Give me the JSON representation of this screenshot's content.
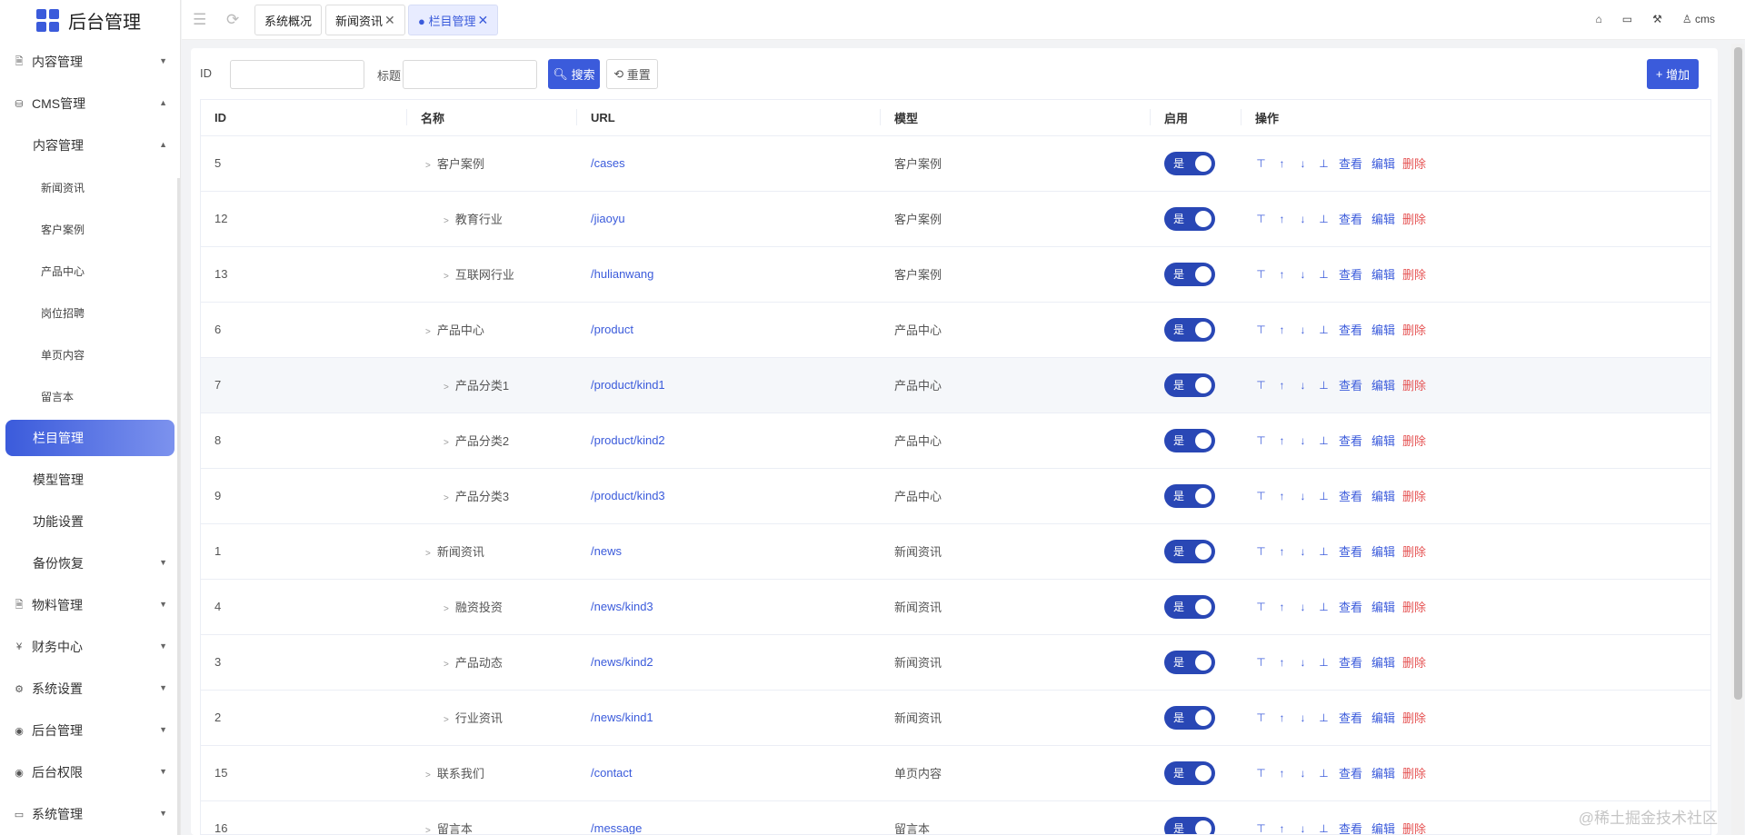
{
  "app": {
    "title": "后台管理",
    "user": "cms"
  },
  "sidebar": {
    "items": [
      {
        "label": "内容管理",
        "icon": "document-icon",
        "level": 1,
        "arrow": "down"
      },
      {
        "label": "CMS管理",
        "icon": "database-icon",
        "level": 1,
        "arrow": "up"
      },
      {
        "label": "内容管理",
        "level": 2,
        "arrow": "up"
      },
      {
        "label": "新闻资讯",
        "level": 3
      },
      {
        "label": "客户案例",
        "level": 3
      },
      {
        "label": "产品中心",
        "level": 3
      },
      {
        "label": "岗位招聘",
        "level": 3
      },
      {
        "label": "单页内容",
        "level": 3
      },
      {
        "label": "留言本",
        "level": 3
      },
      {
        "label": "栏目管理",
        "level": 2,
        "active": true
      },
      {
        "label": "模型管理",
        "level": 2
      },
      {
        "label": "功能设置",
        "level": 2
      },
      {
        "label": "备份恢复",
        "level": 2,
        "arrow": "down"
      },
      {
        "label": "物料管理",
        "icon": "document-icon",
        "level": 1,
        "arrow": "down"
      },
      {
        "label": "财务中心",
        "icon": "yen-icon",
        "level": 1,
        "arrow": "down"
      },
      {
        "label": "系统设置",
        "icon": "gear-icon",
        "level": 1,
        "arrow": "down"
      },
      {
        "label": "后台管理",
        "icon": "user-circle-icon",
        "level": 1,
        "arrow": "down"
      },
      {
        "label": "后台权限",
        "icon": "user-circle-icon",
        "level": 1,
        "arrow": "down"
      },
      {
        "label": "系统管理",
        "icon": "monitor-icon",
        "level": 1,
        "arrow": "down"
      }
    ]
  },
  "tabs": [
    {
      "label": "系统概况",
      "closable": false
    },
    {
      "label": "新闻资讯",
      "closable": true
    },
    {
      "label": "● 栏目管理",
      "closable": true,
      "active": true
    }
  ],
  "filter": {
    "id_label": "ID",
    "id_value": "",
    "title_label": "标题",
    "title_value": "",
    "search_label": "搜索",
    "reset_label": "重置",
    "add_label": "增加"
  },
  "table": {
    "headers": [
      "ID",
      "名称",
      "URL",
      "模型",
      "启用",
      "操作"
    ],
    "switch_label": "是",
    "actions": {
      "view": "查看",
      "edit": "编辑",
      "delete": "删除"
    },
    "rows": [
      {
        "id": "5",
        "name": "客户案例",
        "depth": 1,
        "url": "/cases",
        "model": "客户案例"
      },
      {
        "id": "12",
        "name": "教育行业",
        "depth": 2,
        "url": "/jiaoyu",
        "model": "客户案例"
      },
      {
        "id": "13",
        "name": "互联网行业",
        "depth": 2,
        "url": "/hulianwang",
        "model": "客户案例"
      },
      {
        "id": "6",
        "name": "产品中心",
        "depth": 1,
        "url": "/product",
        "model": "产品中心"
      },
      {
        "id": "7",
        "name": "产品分类1",
        "depth": 2,
        "url": "/product/kind1",
        "model": "产品中心",
        "highlight": true
      },
      {
        "id": "8",
        "name": "产品分类2",
        "depth": 2,
        "url": "/product/kind2",
        "model": "产品中心"
      },
      {
        "id": "9",
        "name": "产品分类3",
        "depth": 2,
        "url": "/product/kind3",
        "model": "产品中心"
      },
      {
        "id": "1",
        "name": "新闻资讯",
        "depth": 1,
        "url": "/news",
        "model": "新闻资讯"
      },
      {
        "id": "4",
        "name": "融资投资",
        "depth": 2,
        "url": "/news/kind3",
        "model": "新闻资讯"
      },
      {
        "id": "3",
        "name": "产品动态",
        "depth": 2,
        "url": "/news/kind2",
        "model": "新闻资讯"
      },
      {
        "id": "2",
        "name": "行业资讯",
        "depth": 2,
        "url": "/news/kind1",
        "model": "新闻资讯"
      },
      {
        "id": "15",
        "name": "联系我们",
        "depth": 1,
        "url": "/contact",
        "model": "单页内容"
      },
      {
        "id": "16",
        "name": "留言本",
        "depth": 1,
        "url": "/message",
        "model": "留言本"
      }
    ]
  },
  "watermark": "@稀土掘金技术社区",
  "colors": {
    "primary": "#3b5bdb",
    "danger": "#e55353",
    "switch_on": "#2947b5"
  }
}
